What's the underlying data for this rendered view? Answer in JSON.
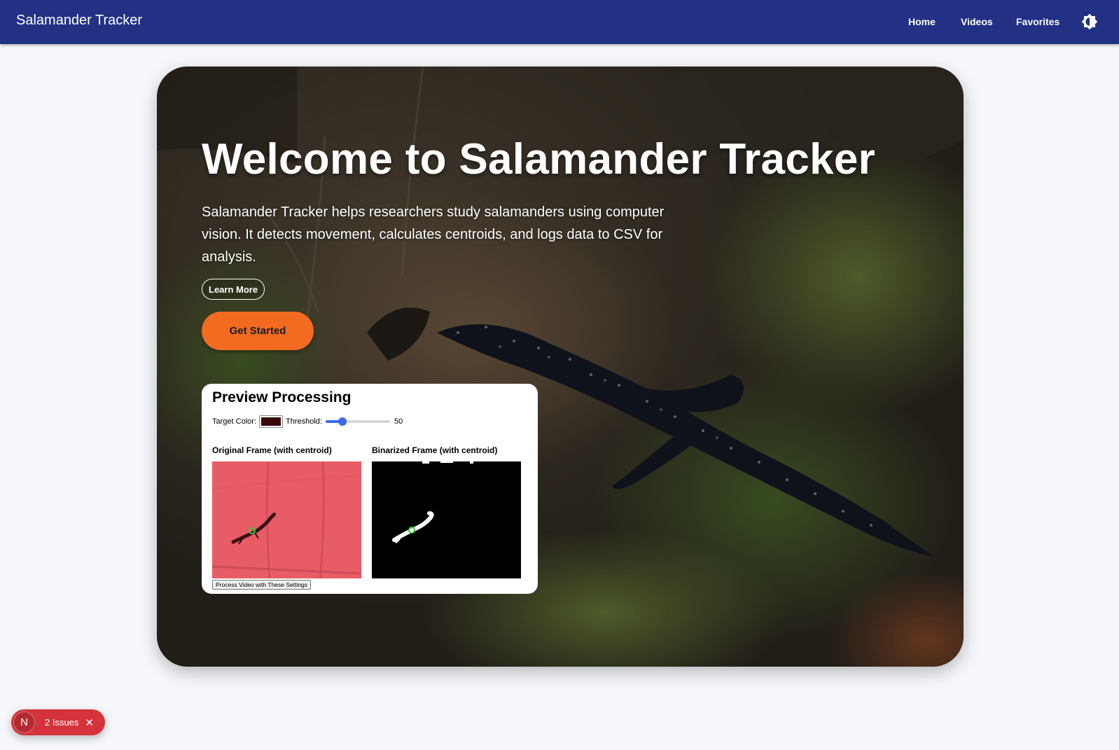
{
  "navbar": {
    "brand": "Salamander Tracker",
    "links": [
      {
        "label": "Home"
      },
      {
        "label": "Videos"
      },
      {
        "label": "Favorites"
      }
    ],
    "theme_toggle_icon": "brightness-icon",
    "background": "#233185"
  },
  "hero": {
    "title": "Welcome to Salamander Tracker",
    "description": "Salamander Tracker helps researchers study salamanders using computer vision. It detects movement, calculates centroids, and logs data to CSV for analysis.",
    "learn_more_label": "Learn More",
    "get_started_label": "Get Started",
    "accent": "#f26b21"
  },
  "preview": {
    "title": "Preview Processing",
    "target_color_label": "Target Color:",
    "target_color": "#3a0a0a",
    "threshold_label": "Threshold:",
    "threshold_value": "50",
    "threshold_fraction": 0.2,
    "original_label": "Original Frame (with centroid)",
    "binarized_label": "Binarized Frame (with centroid)",
    "process_button_label": "Process Video with These Settings"
  },
  "issues": {
    "letter": "N",
    "label": "2 Issues",
    "close_icon": "close-icon",
    "color": "#d5333b"
  }
}
